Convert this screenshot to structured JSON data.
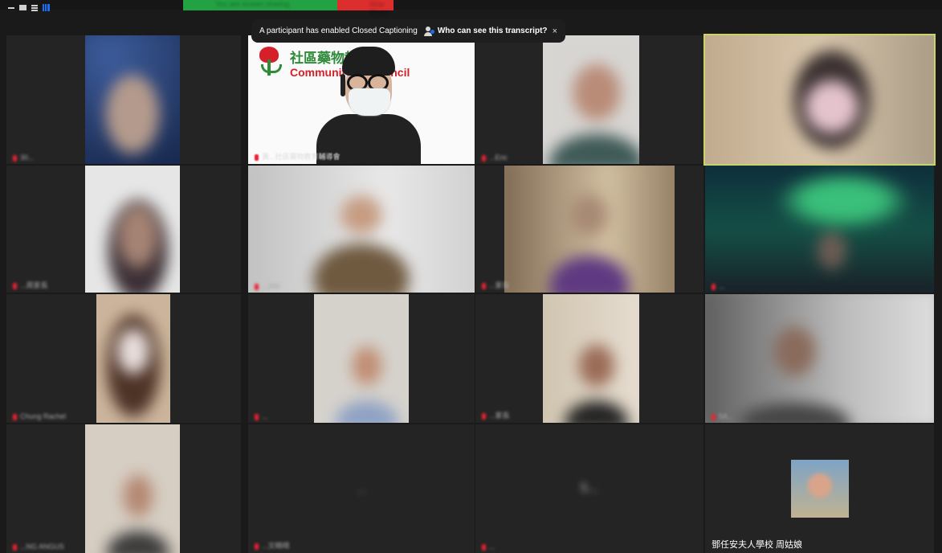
{
  "window": {
    "view_icons": [
      "minimize-view-icon",
      "speaker-view-icon",
      "stack-view-icon",
      "gallery-view-icon"
    ],
    "screen_share_bar": {
      "label": "You are screen sharing",
      "stop_label": "Stop Share"
    }
  },
  "caption_banner": {
    "message": "A participant has enabled Closed Captioning",
    "link": "Who can see this transcript?",
    "close": "×"
  },
  "speaker": {
    "org_zh": "社區藥物教",
    "org_en": "Community          ry Council",
    "name": "黃...社區藥物教育輔導會"
  },
  "participants": [
    {
      "name": "30...",
      "muted": true
    },
    {
      "name": "...Eric",
      "muted": true
    },
    {
      "name": "",
      "muted": false
    },
    {
      "name": "...周家長",
      "muted": true
    },
    {
      "name": "...386",
      "muted": true
    },
    {
      "name": "...家長",
      "muted": true
    },
    {
      "name": "...",
      "muted": true
    },
    {
      "name": "Chung Rachel",
      "muted": true
    },
    {
      "name": "...",
      "muted": true
    },
    {
      "name": "...家長",
      "muted": true
    },
    {
      "name": "5A...",
      "muted": true
    },
    {
      "name": "...NG ANGUS",
      "muted": true
    },
    {
      "name": "...文曉晴",
      "muted": true
    },
    {
      "name": "...",
      "muted": true
    },
    {
      "name": "鄧任安夫人學校 周姑娘",
      "muted": false
    }
  ],
  "placeholders": [
    "...",
    "5...",
    ""
  ]
}
